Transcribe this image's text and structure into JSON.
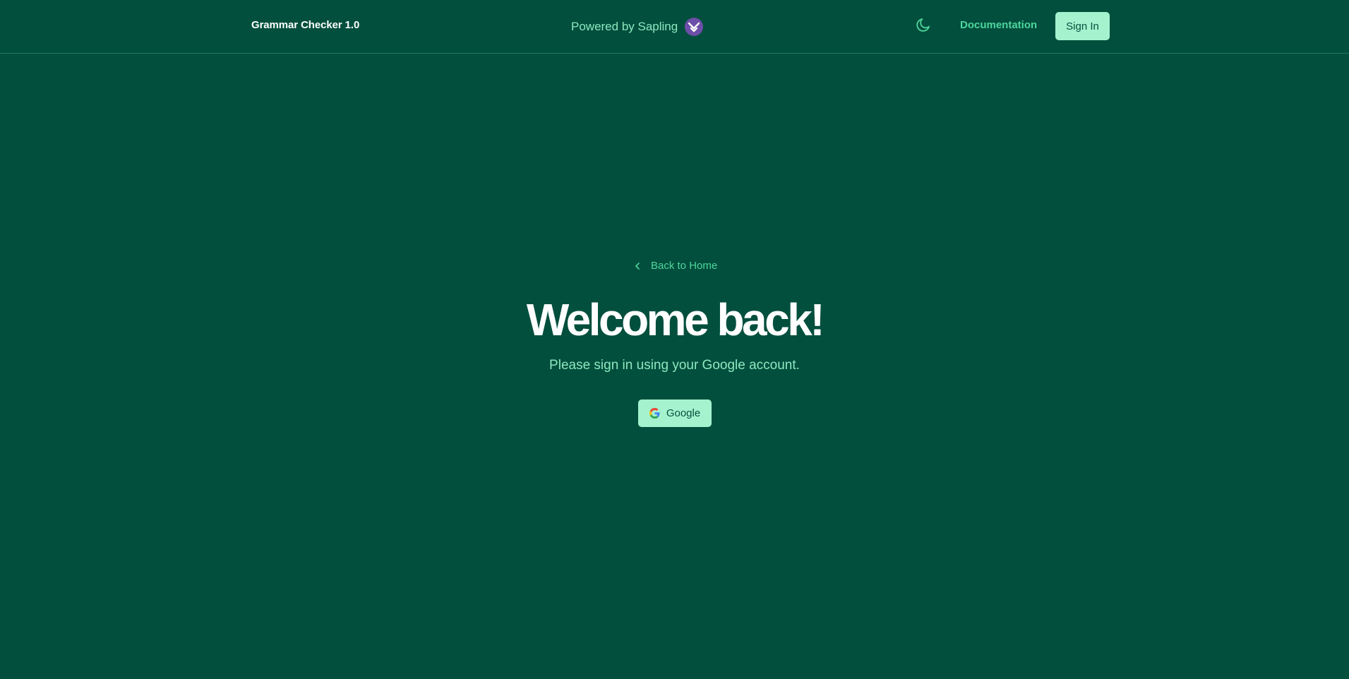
{
  "header": {
    "app_title": "Grammar Checker 1.0",
    "powered_by": "Powered by Sapling",
    "powered_logo_icon": "sapling-logo-icon",
    "theme_toggle_icon": "moon-icon",
    "documentation_label": "Documentation",
    "signin_label": "Sign In"
  },
  "main": {
    "back_label": "Back to Home",
    "back_icon": "chevron-left-icon",
    "title": "Welcome back!",
    "subtitle": "Please sign in using your Google account.",
    "google_button_label": "Google",
    "google_icon": "google-g-icon"
  },
  "colors": {
    "background": "#024f3d",
    "accent_text": "#4fd69c",
    "light_text": "#8ce8bf",
    "button_bg": "#a5f2cf",
    "button_text": "#05513f",
    "logo_purple": "#6c4fa8"
  }
}
